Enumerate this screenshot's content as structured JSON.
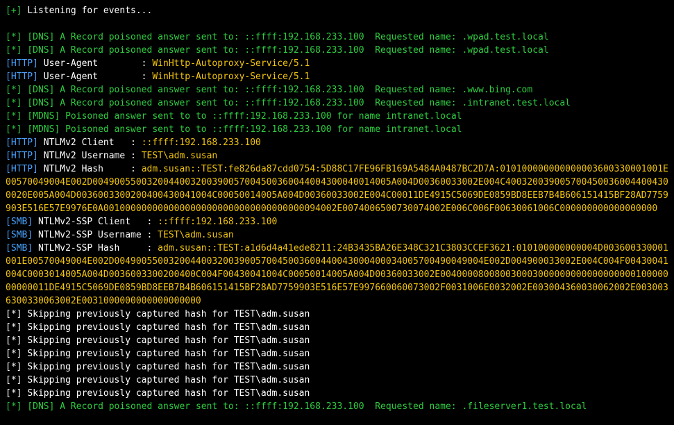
{
  "t": {
    "plus": "[+]",
    "star": "[*]",
    "DNS": "[DNS]",
    "MDNS": "[MDNS]",
    "HTTP": "[HTTP]",
    "SMB": "[SMB]",
    "listen": "Listening for events...",
    "dns_pois": "A Record poisoned answer sent to:",
    "mdns_pois": "Poisoned answer sent to",
    "reqname": "Requested name:",
    "fname": "for name",
    "ua_lbl": "User-Agent        :",
    "ntlm_client": "NTLMv2 Client   :",
    "ntlm_user": "NTLMv2 Username :",
    "ntlm_hash": "NTLMv2 Hash     :",
    "ssp_client": "NTLMv2-SSP Client   :",
    "ssp_user": "NTLMv2-SSP Username :",
    "ssp_hash": "NTLMv2-SSP Hash     :",
    "skip": "Skipping previously captured hash for TEST\\adm.susan"
  },
  "ip": "::ffff:192.168.233.100",
  "ua": "WinHttp-Autoproxy-Service/5.1",
  "mdns_name": "intranet.local",
  "user": "TEST\\adm.susan",
  "names": {
    "wpad": ".wpad.test.local",
    "bing": ".www.bing.com",
    "intranet": ".intranet.test.local",
    "fileserver": ".fileserver1.test.local"
  },
  "hash_http": "adm.susan::TEST:fe826da87cdd0754:5D88C17FE96FB169A5484A0487BC2D7A:010100000000000003600330001001E00570049004E002D0049005500320044003200390057004500360044004300040014005A004D00360033002E004C4003200390057004500360044004300020E005A004D0036003300200400430041004C00050014005A004D00360033002E004C00011DE4915C5069DE0859BD8EEB7B4B606151415BF28AD7759903E516E57E9976E0A0010000000000000000000000000000000000094002E0074006500730074002E006C006F00630061006C000000000000000000",
  "hash_smb": "adm.susan::TEST:a1d6d4a41ede8211:24B3435BA26E348C321C3803CCEF3621:010100000000004D003600330001001E00570049004E002D00490055003200440032003900570045003600440043000400034005700490049004E002D004900033002E004C004F00430041004C0003014005A004D0036003300200400C004F00430041004C00050014005A004D00360033002E00400008008003000300000000000000000010000000000011DE4915C5069DE0859BD8EEB7B4B606151415BF28AD7759903E516E57E997660060073002F0031006E0032002E003004360030062002E0030036300330063002E0031000000000000000000"
}
